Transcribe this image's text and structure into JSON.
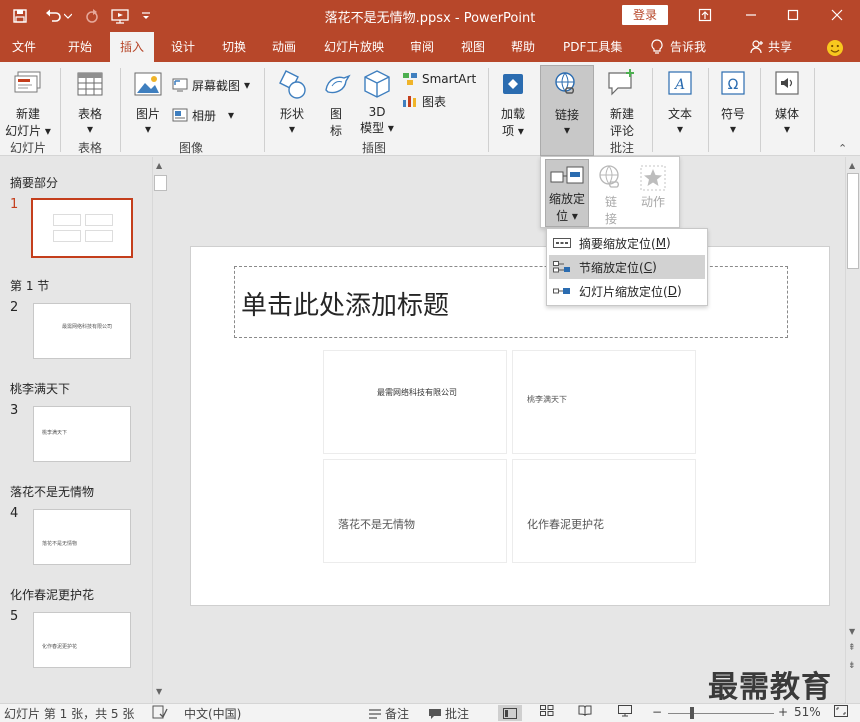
{
  "window": {
    "title": "落花不是无情物.ppsx  -  PowerPoint",
    "login_label": "登录"
  },
  "tabs": [
    "文件",
    "开始",
    "插入",
    "设计",
    "切换",
    "动画",
    "幻灯片放映",
    "审阅",
    "视图",
    "帮助",
    "PDF工具集"
  ],
  "tell_me": "告诉我",
  "share": "共享",
  "ribbon": {
    "new_slide": [
      "新建",
      "幻灯片"
    ],
    "table": "表格",
    "picture": "图片",
    "screenshot": "屏幕截图",
    "album": "相册",
    "shapes": "形状",
    "icons": [
      "图",
      "标"
    ],
    "model3d": [
      "3D",
      "模型"
    ],
    "smartart": "SmartArt",
    "chart": "图表",
    "addins": [
      "加载",
      "项"
    ],
    "link": "链接",
    "new_comment": [
      "新建",
      "评论"
    ],
    "text": "文本",
    "symbols": "符号",
    "media": "媒体",
    "groups": {
      "slides": "幻灯片",
      "tables": "表格",
      "images": "图像",
      "illustrations": "插图",
      "comments": "批注"
    }
  },
  "link_panel": {
    "zoom": [
      "缩放定",
      "位"
    ],
    "link": [
      "链",
      "接"
    ],
    "action": "动作"
  },
  "zoom_menu": [
    {
      "label": "摘要缩放定位(",
      "key": "M",
      "suffix": ")"
    },
    {
      "label": "节缩放定位(",
      "key": "C",
      "suffix": ")"
    },
    {
      "label": "幻灯片缩放定位(",
      "key": "D",
      "suffix": ")"
    }
  ],
  "sections": [
    {
      "name": "摘要部分",
      "num": "1"
    },
    {
      "name": "第 1 节",
      "num": "2",
      "thumb_text": "最需网络科技有限公司"
    },
    {
      "name": "桃李满天下",
      "num": "3",
      "thumb_text": "桃李满天下"
    },
    {
      "name": "落花不是无情物",
      "num": "4",
      "thumb_text": "落花不是无情物"
    },
    {
      "name": "化作春泥更护花",
      "num": "5",
      "thumb_text": "化作春泥更护花"
    }
  ],
  "slide": {
    "title_placeholder": "单击此处添加标题",
    "cells": [
      "最需网络科技有限公司",
      "桃李满天下",
      "落花不是无情物",
      "化作春泥更护花"
    ]
  },
  "status": {
    "slide_info": "幻灯片 第 1 张，共 5 张",
    "language": "中文(中国)",
    "notes": "备注",
    "comments": "批注",
    "zoom": "51%"
  },
  "watermark": "最需教育",
  "colors": {
    "accent": "#b7472a",
    "selected": "#c43e1c"
  }
}
